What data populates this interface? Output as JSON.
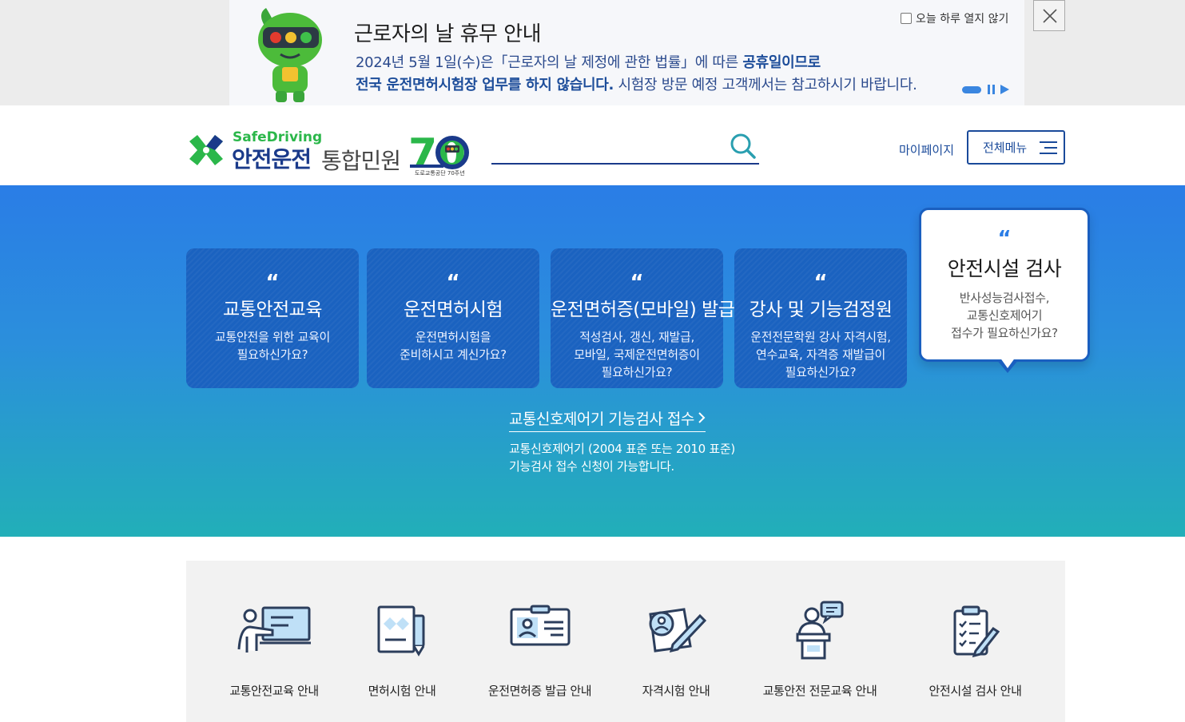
{
  "notice": {
    "title": "근로자의 날 휴무 안내",
    "line1_pre": "2024년 5월 1일(수)은「근로자의 날 제정에 관한 법률」에 따른 ",
    "line1_bold": "공휴일이므로",
    "line2_bold": "전국 운전면허시험장 업무를 하지 않습니다.",
    "line2_post": " 시험장 방문 예정 고객께서는 참고하시기 바랍니다.",
    "dismiss_label": "오늘 하루 열지 않기",
    "close_icon": "close-icon"
  },
  "header": {
    "logo_en": "SafeDriving",
    "logo_ko": "안전운전",
    "logo_service": "통합민원",
    "anniv_number": "70",
    "anniv_caption": "도로교통공단 70주년",
    "search_placeholder": "",
    "mypage_label": "마이페이지",
    "allmenu_label": "전체메뉴"
  },
  "hero": {
    "quote_mark": "“",
    "cards": [
      {
        "title": "교통안전교육",
        "desc": "교통안전을 위한 교육이\n필요하신가요?"
      },
      {
        "title": "운전면허시험",
        "desc": "운전면허시험을\n준비하시고 계신가요?"
      },
      {
        "title": "운전면허증(모바일) 발급",
        "desc": "적성검사, 갱신, 재발급,\n모바일, 국제운전면허증이\n필요하신가요?"
      },
      {
        "title": "강사 및 기능검정원",
        "desc": "운전전문학원 강사 자격시험,\n연수교육, 자격증 재발급이\n필요하신가요?"
      },
      {
        "title": "안전시설 검사",
        "desc": "반사성능검사접수,\n교통신호제어기\n접수가 필요하신가요?",
        "active": true
      }
    ],
    "link_label": "교통신호제어기 기능검사 접수",
    "link_desc": "교통신호제어기 (2004 표준 또는 2010 표준)\n기능검사 접수 신청이 가능합니다."
  },
  "quick_menu": [
    {
      "label": "교통안전교육 안내",
      "icon": "presentation-icon"
    },
    {
      "label": "면허시험 안내",
      "icon": "document-pen-icon"
    },
    {
      "label": "운전면허증 발급 안내",
      "icon": "id-card-icon"
    },
    {
      "label": "자격시험 안내",
      "icon": "exam-icon"
    },
    {
      "label": "교통안전 전문교육 안내",
      "icon": "lecturer-icon"
    },
    {
      "label": "안전시설 검사 안내",
      "icon": "checklist-icon"
    }
  ],
  "colors": {
    "brand_navy": "#1a3a8a",
    "brand_green": "#2bb74a",
    "hero_top": "#2a7de6",
    "hero_bottom": "#22afb8",
    "card_blue": "#1a62c0"
  }
}
